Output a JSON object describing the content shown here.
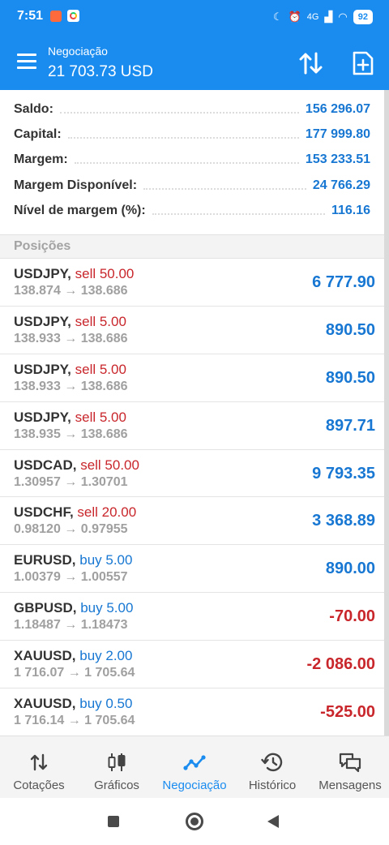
{
  "status_bar": {
    "time": "7:51",
    "network": "4G",
    "battery": "92"
  },
  "header": {
    "subtitle": "Negociação",
    "title": "21 703.73 USD",
    "icons": [
      "menu-icon",
      "sort-icon",
      "add-order-icon"
    ]
  },
  "summary": [
    {
      "label": "Saldo:",
      "value": "156 296.07"
    },
    {
      "label": "Capital:",
      "value": "177 999.80"
    },
    {
      "label": "Margem:",
      "value": "153 233.51"
    },
    {
      "label": "Margem Disponível:",
      "value": "24 766.29"
    },
    {
      "label": "Nível de margem (%):",
      "value": "116.16"
    }
  ],
  "positions_header": "Posições",
  "positions": [
    {
      "symbol": "USDJPY,",
      "action": "sell 50.00",
      "side": "sell",
      "prices": "138.874 → 138.686",
      "profit": "6 777.90",
      "direction": "up"
    },
    {
      "symbol": "USDJPY,",
      "action": "sell 5.00",
      "side": "sell",
      "prices": "138.933 → 138.686",
      "profit": "890.50",
      "direction": "up"
    },
    {
      "symbol": "USDJPY,",
      "action": "sell 5.00",
      "side": "sell",
      "prices": "138.933 → 138.686",
      "profit": "890.50",
      "direction": "up"
    },
    {
      "symbol": "USDJPY,",
      "action": "sell 5.00",
      "side": "sell",
      "prices": "138.935 → 138.686",
      "profit": "897.71",
      "direction": "up"
    },
    {
      "symbol": "USDCAD,",
      "action": "sell 50.00",
      "side": "sell",
      "prices": "1.30957 → 1.30701",
      "profit": "9 793.35",
      "direction": "up"
    },
    {
      "symbol": "USDCHF,",
      "action": "sell 20.00",
      "side": "sell",
      "prices": "0.98120 → 0.97955",
      "profit": "3 368.89",
      "direction": "up"
    },
    {
      "symbol": "EURUSD,",
      "action": "buy 5.00",
      "side": "buy",
      "prices": "1.00379 → 1.00557",
      "profit": "890.00",
      "direction": "up"
    },
    {
      "symbol": "GBPUSD,",
      "action": "buy 5.00",
      "side": "buy",
      "prices": "1.18487 → 1.18473",
      "profit": "-70.00",
      "direction": "down"
    },
    {
      "symbol": "XAUUSD,",
      "action": "buy 2.00",
      "side": "buy",
      "prices": "1 716.07 → 1 705.64",
      "profit": "-2 086.00",
      "direction": "down"
    },
    {
      "symbol": "XAUUSD,",
      "action": "buy 0.50",
      "side": "buy",
      "prices": "1 716.14 → 1 705.64",
      "profit": "-525.00",
      "direction": "down"
    }
  ],
  "nav": [
    {
      "label": "Cotações",
      "icon": "quotes-icon",
      "active": false
    },
    {
      "label": "Gráficos",
      "icon": "charts-icon",
      "active": false
    },
    {
      "label": "Negociação",
      "icon": "trade-icon",
      "active": true
    },
    {
      "label": "Histórico",
      "icon": "history-icon",
      "active": false
    },
    {
      "label": "Mensagens",
      "icon": "messages-icon",
      "active": false
    }
  ],
  "colors": {
    "header_bg": "#1a8cf0",
    "value_blue": "#1777d2",
    "sell_red": "#c8262b"
  }
}
